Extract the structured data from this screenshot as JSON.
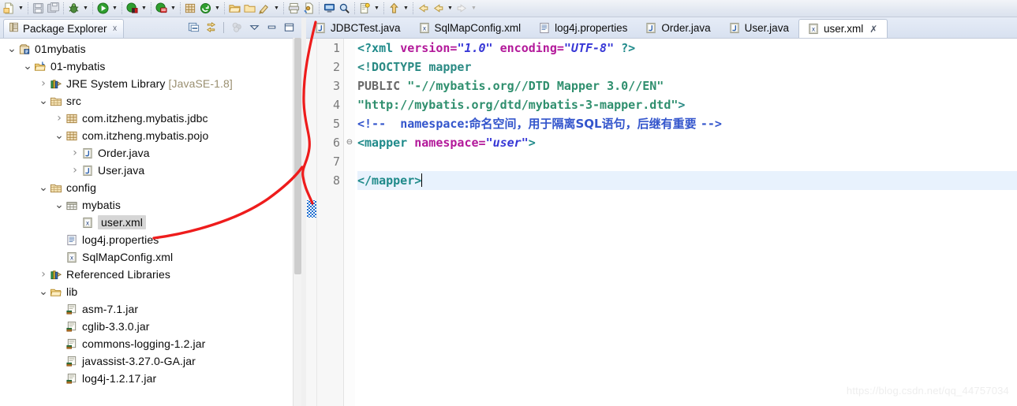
{
  "toolbar": {
    "groups": [
      {
        "items": [
          {
            "icon": "new-file-icon",
            "arrow": true
          },
          {
            "icon": "save-icon",
            "arrow": false
          },
          {
            "icon": "save-all-icon",
            "arrow": false
          }
        ]
      },
      {
        "items": [
          {
            "icon": "debug-icon",
            "arrow": true
          },
          {
            "icon": "run-icon",
            "arrow": true
          },
          {
            "icon": "run-external-tools-icon",
            "arrow": true
          },
          {
            "icon": "coverage-icon",
            "arrow": true
          }
        ]
      },
      {
        "items": [
          {
            "icon": "new-java-package-icon",
            "arrow": false
          },
          {
            "icon": "git-repository-icon",
            "arrow": true
          },
          {
            "icon": "open-folder-icon",
            "arrow": false
          },
          {
            "icon": "open-resource-icon",
            "arrow": false
          },
          {
            "icon": "quick-access-icon",
            "arrow": true
          }
        ]
      },
      {
        "items": [
          {
            "icon": "print-icon",
            "arrow": false
          },
          {
            "icon": "new-class-icon",
            "arrow": false
          }
        ]
      },
      {
        "items": [
          {
            "icon": "server-icon",
            "arrow": false
          },
          {
            "icon": "search-icon",
            "arrow": false
          },
          {
            "icon": "profile-icon",
            "arrow": true
          },
          {
            "icon": "previous-annotation-icon",
            "arrow": true
          },
          {
            "icon": "next-edit-icon",
            "arrow": false
          },
          {
            "icon": "back-navigation-icon",
            "arrow": true
          },
          {
            "icon": "forward-navigation-icon",
            "arrow": true
          }
        ]
      }
    ]
  },
  "explorer": {
    "title": "Package Explorer",
    "title_icon": "package-explorer-icon",
    "close_icon": "close-icon",
    "tools": [
      {
        "name": "collapse-all-icon",
        "enabled": true
      },
      {
        "name": "link-with-editor-icon",
        "enabled": true
      },
      {
        "name": "focus-on-active-task-icon",
        "enabled": false
      },
      {
        "name": "view-menu-icon",
        "enabled": true
      },
      {
        "name": "minimize-icon",
        "enabled": true
      },
      {
        "name": "maximize-icon",
        "enabled": true
      }
    ],
    "tree": [
      {
        "indent": 0,
        "arrow": "open",
        "icon": "java-project-icon",
        "label": "01mybatis",
        "dim": "",
        "selected": false
      },
      {
        "indent": 1,
        "arrow": "open",
        "icon": "source-folder-open-icon",
        "label": "01-mybatis",
        "dim": "",
        "selected": false
      },
      {
        "indent": 2,
        "arrow": "closed",
        "icon": "jre-library-icon",
        "label": "JRE System Library ",
        "dim": "[JavaSE-1.8]",
        "selected": false
      },
      {
        "indent": 2,
        "arrow": "open",
        "icon": "source-folder-icon",
        "label": "src",
        "dim": "",
        "selected": false
      },
      {
        "indent": 3,
        "arrow": "closed",
        "icon": "package-icon",
        "label": "com.itzheng.mybatis.jdbc",
        "dim": "",
        "selected": false
      },
      {
        "indent": 3,
        "arrow": "open",
        "icon": "package-icon",
        "label": "com.itzheng.mybatis.pojo",
        "dim": "",
        "selected": false
      },
      {
        "indent": 4,
        "arrow": "closed",
        "icon": "java-file-icon",
        "label": "Order.java",
        "dim": "",
        "selected": false
      },
      {
        "indent": 4,
        "arrow": "closed",
        "icon": "java-file-icon",
        "label": "User.java",
        "dim": "",
        "selected": false
      },
      {
        "indent": 2,
        "arrow": "open",
        "icon": "source-folder-icon",
        "label": "config",
        "dim": "",
        "selected": false
      },
      {
        "indent": 3,
        "arrow": "open",
        "icon": "folder-package-icon",
        "label": "mybatis",
        "dim": "",
        "selected": false
      },
      {
        "indent": 4,
        "arrow": "none",
        "icon": "xml-file-icon",
        "label": "user.xml",
        "dim": "",
        "selected": true
      },
      {
        "indent": 3,
        "arrow": "none",
        "icon": "properties-file-icon",
        "label": "log4j.properties",
        "dim": "",
        "selected": false
      },
      {
        "indent": 3,
        "arrow": "none",
        "icon": "xml-file-icon",
        "label": "SqlMapConfig.xml",
        "dim": "",
        "selected": false
      },
      {
        "indent": 2,
        "arrow": "closed",
        "icon": "referenced-libraries-icon",
        "label": "Referenced Libraries",
        "dim": "",
        "selected": false
      },
      {
        "indent": 2,
        "arrow": "open",
        "icon": "folder-icon",
        "label": "lib",
        "dim": "",
        "selected": false
      },
      {
        "indent": 3,
        "arrow": "none",
        "icon": "jar-file-icon",
        "label": "asm-7.1.jar",
        "dim": "",
        "selected": false
      },
      {
        "indent": 3,
        "arrow": "none",
        "icon": "jar-file-icon",
        "label": "cglib-3.3.0.jar",
        "dim": "",
        "selected": false
      },
      {
        "indent": 3,
        "arrow": "none",
        "icon": "jar-file-icon",
        "label": "commons-logging-1.2.jar",
        "dim": "",
        "selected": false
      },
      {
        "indent": 3,
        "arrow": "none",
        "icon": "jar-file-icon",
        "label": "javassist-3.27.0-GA.jar",
        "dim": "",
        "selected": false
      },
      {
        "indent": 3,
        "arrow": "none",
        "icon": "jar-file-icon",
        "label": "log4j-1.2.17.jar",
        "dim": "",
        "selected": false
      }
    ]
  },
  "editor": {
    "tabs": [
      {
        "label": "JDBCTest.java",
        "icon": "java-file-icon",
        "active": false,
        "closable": false
      },
      {
        "label": "SqlMapConfig.xml",
        "icon": "xml-file-icon",
        "active": false,
        "closable": false
      },
      {
        "label": "log4j.properties",
        "icon": "properties-file-icon",
        "active": false,
        "closable": false
      },
      {
        "label": "Order.java",
        "icon": "java-file-icon",
        "active": false,
        "closable": false
      },
      {
        "label": "User.java",
        "icon": "java-file-icon",
        "active": false,
        "closable": false
      },
      {
        "label": "user.xml",
        "icon": "xml-file-icon",
        "active": true,
        "closable": true
      }
    ],
    "close_icon": "close-icon",
    "lines": [
      {
        "no": "1",
        "fold": "",
        "highlight": false
      },
      {
        "no": "2",
        "fold": "",
        "highlight": false
      },
      {
        "no": "3",
        "fold": "",
        "highlight": false
      },
      {
        "no": "4",
        "fold": "",
        "highlight": false
      },
      {
        "no": "5",
        "fold": "",
        "highlight": false
      },
      {
        "no": "6",
        "fold": "⊖",
        "highlight": false
      },
      {
        "no": "7",
        "fold": "",
        "highlight": false
      },
      {
        "no": "8",
        "fold": "",
        "highlight": true
      }
    ],
    "code": {
      "l1_tag_open": "<?xml",
      "l1_attr1": "version",
      "l1_eq": "=",
      "l1_val1": "\"1.0\"",
      "l1_attr2": "encoding",
      "l1_val2": "\"UTF-8\"",
      "l1_tag_close": "?>",
      "l2_doctype": "<!DOCTYPE",
      "l2_name": "mapper",
      "l3_public": "PUBLIC",
      "l3_id": "\"-//mybatis.org//DTD Mapper 3.0//EN\"",
      "l4_url": "\"http://mybatis.org/dtd/mybatis-3-mapper.dtd\"",
      "l4_gt": ">",
      "l5_open": "<!--  ",
      "l5_word": "namespace",
      "l5_text": ":命名空间，用于隔离SQL语句，后继有重要 ",
      "l5_close": "-->",
      "l6_tag": "<mapper",
      "l6_attr": "namespace",
      "l6_val": "\"user\"",
      "l6_gt": ">",
      "l8_tag": "</mapper>"
    }
  },
  "annotation": {
    "color": "#ee1c1c",
    "description": "hand-drawn red arrow from user.xml tree node to the editor tab area"
  },
  "watermark": {
    "text": "https://blog.csdn.net/qq_44757034"
  }
}
